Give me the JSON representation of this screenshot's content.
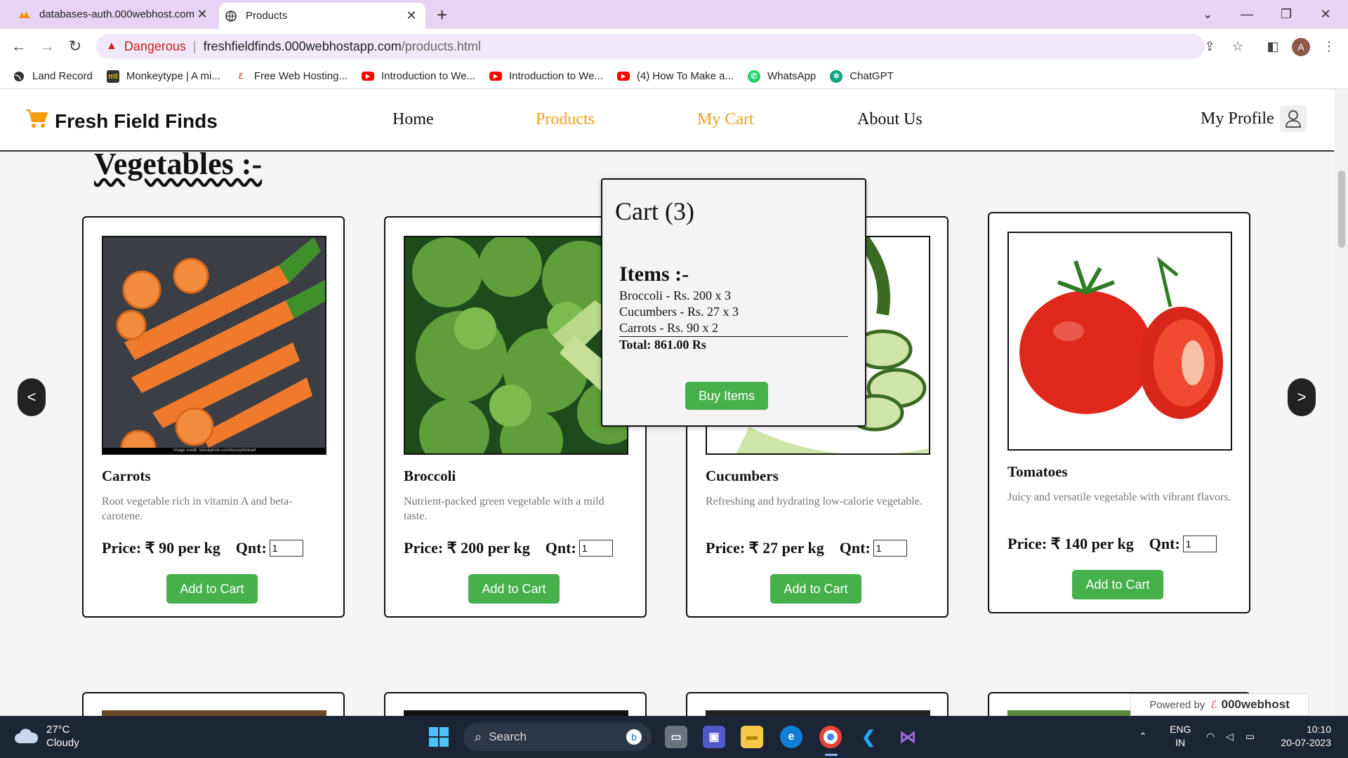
{
  "browser": {
    "tabs": [
      {
        "title": "databases-auth.000webhost.com",
        "active": false
      },
      {
        "title": "Products",
        "active": true
      }
    ],
    "security_label": "Dangerous",
    "url_host": "freshfieldfinds.000webhostapp.com",
    "url_path": "/products.html",
    "profile_initial": "A",
    "bookmarks": [
      {
        "label": "Land Record",
        "icon": "globe-icon"
      },
      {
        "label": "Monkeytype | A mi...",
        "icon": "monkeytype-icon"
      },
      {
        "label": "Free Web Hosting...",
        "icon": "000webhost-icon"
      },
      {
        "label": "Introduction to We...",
        "icon": "youtube-icon"
      },
      {
        "label": "Introduction to We...",
        "icon": "youtube-icon"
      },
      {
        "label": "(4) How To Make a...",
        "icon": "youtube-icon"
      },
      {
        "label": "WhatsApp",
        "icon": "whatsapp-icon"
      },
      {
        "label": "ChatGPT",
        "icon": "chatgpt-icon"
      }
    ]
  },
  "site": {
    "brand": "Fresh Field Finds",
    "nav": [
      {
        "label": "Home",
        "highlight": false
      },
      {
        "label": "Products",
        "highlight": true
      },
      {
        "label": "My Cart",
        "highlight": true
      },
      {
        "label": "About Us",
        "highlight": false
      }
    ],
    "profile_label": "My Profile",
    "section_title": "Vegetables :-",
    "prev_label": "<",
    "next_label": ">",
    "products": [
      {
        "name": "Carrots",
        "description": "Root vegetable rich in vitamin A and beta-carotene.",
        "price": "Price: ₹ 90 per kg",
        "qty_label": "Qnt:",
        "qty": "1",
        "button": "Add to Cart",
        "image_credit": "Image credit: istockphoto.com/locusphotoart"
      },
      {
        "name": "Broccoli",
        "description": "Nutrient-packed green vegetable with a mild taste.",
        "price": "Price: ₹ 200 per kg",
        "qty_label": "Qnt:",
        "qty": "1",
        "button": "Add to Cart"
      },
      {
        "name": "Cucumbers",
        "description": "Refreshing and hydrating low-calorie vegetable.",
        "price": "Price: ₹ 27 per kg",
        "qty_label": "Qnt:",
        "qty": "1",
        "button": "Add to Cart"
      },
      {
        "name": "Tomatoes",
        "description": "Juicy and versatile vegetable with vibrant flavors.",
        "price": "Price: ₹ 140 per kg",
        "qty_label": "Qnt:",
        "qty": "1",
        "button": "Add to Cart"
      }
    ],
    "cart": {
      "title": "Cart (3)",
      "items_heading": "Items :-",
      "items": [
        "Broccoli - Rs. 200 x 3",
        "Cucumbers - Rs. 27 x 3",
        "Carrots - Rs. 90 x 2"
      ],
      "total": "Total: 861.00 Rs",
      "button": "Buy Items"
    },
    "powered_by": "Powered by",
    "powered_brand": "000webhost"
  },
  "taskbar": {
    "temp": "27°C",
    "weather": "Cloudy",
    "search_placeholder": "Search",
    "lang_top": "ENG",
    "lang_bottom": "IN",
    "time": "10:10",
    "date": "20-07-2023"
  },
  "colors": {
    "accent_nav": "#f0a020",
    "button_green": "#46b04a",
    "danger": "#c5221f",
    "titlebar": "#e6d3f5"
  }
}
